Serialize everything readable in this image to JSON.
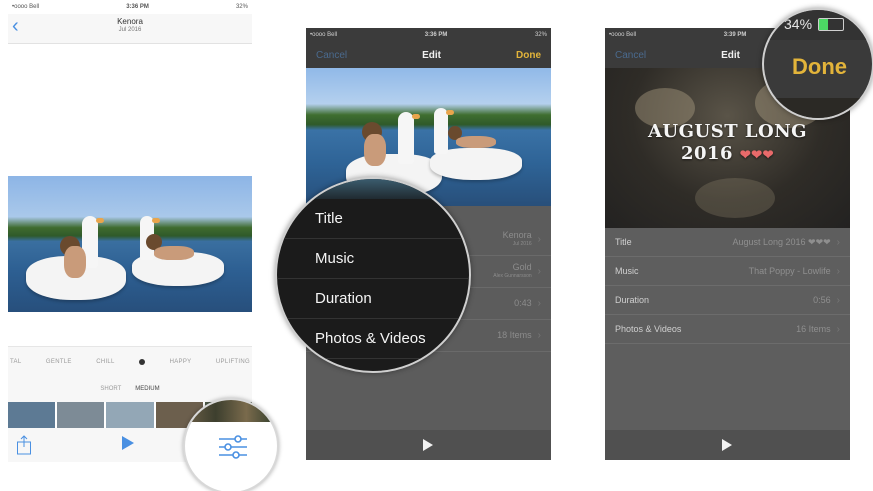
{
  "phone1": {
    "status": {
      "carrier": "•oooo Bell",
      "time": "3:36 PM",
      "battery": "32%"
    },
    "header": {
      "title": "Kenora",
      "subtitle": "Jul 2016"
    },
    "moods": [
      "TAL",
      "GENTLE",
      "CHILL",
      "HAPPY",
      "UPLIFTING"
    ],
    "lengths": [
      "SHORT",
      "MEDIUM"
    ],
    "selected_length": "MEDIUM"
  },
  "phone2": {
    "status": {
      "carrier": "•oooo Bell",
      "time": "3:36 PM",
      "battery": "32%"
    },
    "nav": {
      "cancel": "Cancel",
      "title": "Edit",
      "done": "Done"
    },
    "rows": [
      {
        "label": "Title",
        "value": "Kenora",
        "sub": "Jul 2016"
      },
      {
        "label": "Music",
        "value": "Gold",
        "sub": "Alex Gunnarsson"
      },
      {
        "label": "Duration",
        "value": "0:43",
        "sub": ""
      },
      {
        "label": "Photos & Videos",
        "value": "18 Items",
        "sub": ""
      }
    ]
  },
  "phone3": {
    "status": {
      "carrier": "•oooo Bell",
      "time": "3:39 PM",
      "battery": "34%"
    },
    "nav": {
      "cancel": "Cancel",
      "title": "Edit",
      "done": "Done"
    },
    "movie_title_line1": "AUGUST LONG",
    "movie_title_line2": "2016",
    "hearts": "❤❤❤",
    "rows": [
      {
        "label": "Title",
        "value": "August Long 2016 ❤❤❤"
      },
      {
        "label": "Music",
        "value": "That Poppy - Lowlife"
      },
      {
        "label": "Duration",
        "value": "0:56"
      },
      {
        "label": "Photos & Videos",
        "value": "16 Items"
      }
    ]
  },
  "colors": {
    "accent_blue": "#4a90e2",
    "done_gold": "#e3b43a",
    "battery_green": "#4cd964"
  }
}
